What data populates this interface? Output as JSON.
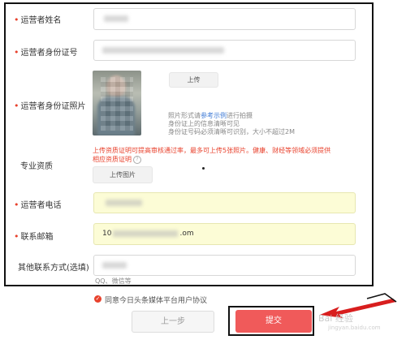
{
  "form": {
    "operator_name_label": "运营者姓名",
    "operator_id_label": "运营者身份证号",
    "operator_id_photo_label": "运营者身份证照片",
    "upload_button": "上传",
    "photo_hint_prefix": "照片形式请",
    "photo_hint_link": "参考示例",
    "photo_hint_suffix": "进行拍摄",
    "photo_hint_line2": "身份证上的信息清晰可见",
    "photo_hint_line3": "身份证号码必须清晰可识别，大小不超过2M",
    "qualification_label": "专业资质",
    "qualification_warning_line1": "上传资质证明可提高审核通过率，最多可上传5张照片。健康、财经等领域必须提供",
    "qualification_warning_line2": "相应资质证明",
    "upload_image_button": "上传图片",
    "phone_label": "运营者电话",
    "email_label": "联系邮箱",
    "email_value": "10",
    "email_value_tail": ".om",
    "other_contact_label": "其他联系方式(选填)",
    "other_contact_hint": "QQ、微信等"
  },
  "agreement": {
    "checkmark": "✓",
    "text": "同意今日头条媒体平台用户协议"
  },
  "actions": {
    "prev_label": "上一步",
    "submit_label": "提交"
  },
  "watermark": {
    "main": "Bai 经验",
    "sub": "jingyan.baidu.com"
  },
  "colors": {
    "accent": "#e8412c",
    "submit": "#f05a5a",
    "link": "#3f7bd6",
    "highlight_field": "#fcfcd6"
  }
}
